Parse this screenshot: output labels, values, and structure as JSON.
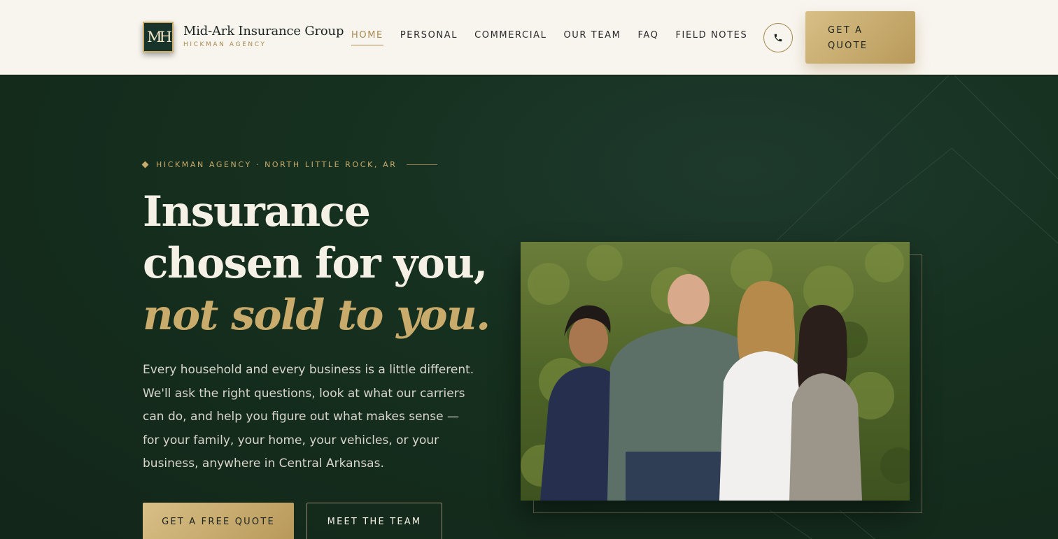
{
  "header": {
    "logo_monogram": "MH",
    "logo_name": "Mid-Ark Insurance Group",
    "logo_sub": "HICKMAN AGENCY",
    "nav": [
      {
        "label": "HOME",
        "active": true
      },
      {
        "label": "PERSONAL",
        "active": false
      },
      {
        "label": "COMMERCIAL",
        "active": false
      },
      {
        "label": "OUR TEAM",
        "active": false
      },
      {
        "label": "FAQ",
        "active": false
      },
      {
        "label": "FIELD NOTES",
        "active": false
      }
    ],
    "phone_icon": "phone-icon",
    "cta_line1": "GET A",
    "cta_line2": "QUOTE"
  },
  "hero": {
    "eyebrow": "HICKMAN AGENCY · NORTH LITTLE ROCK, AR",
    "headline_part1": "Insurance chosen for you,",
    "headline_emphasis": "not sold to you.",
    "lead": "Every household and every business is a little different. We'll ask the right questions, look at what our carriers can do, and help you figure out what makes sense — for your family, your home, your vehicles, or your business, anywhere in Central Arkansas.",
    "primary_button": "GET A FREE QUOTE",
    "secondary_button": "MEET THE TEAM",
    "photo_icon": "team-photo"
  },
  "colors": {
    "accent_gold": "#c9ab6b",
    "hero_green": "#16301f",
    "header_bg": "#f8f5ef"
  }
}
